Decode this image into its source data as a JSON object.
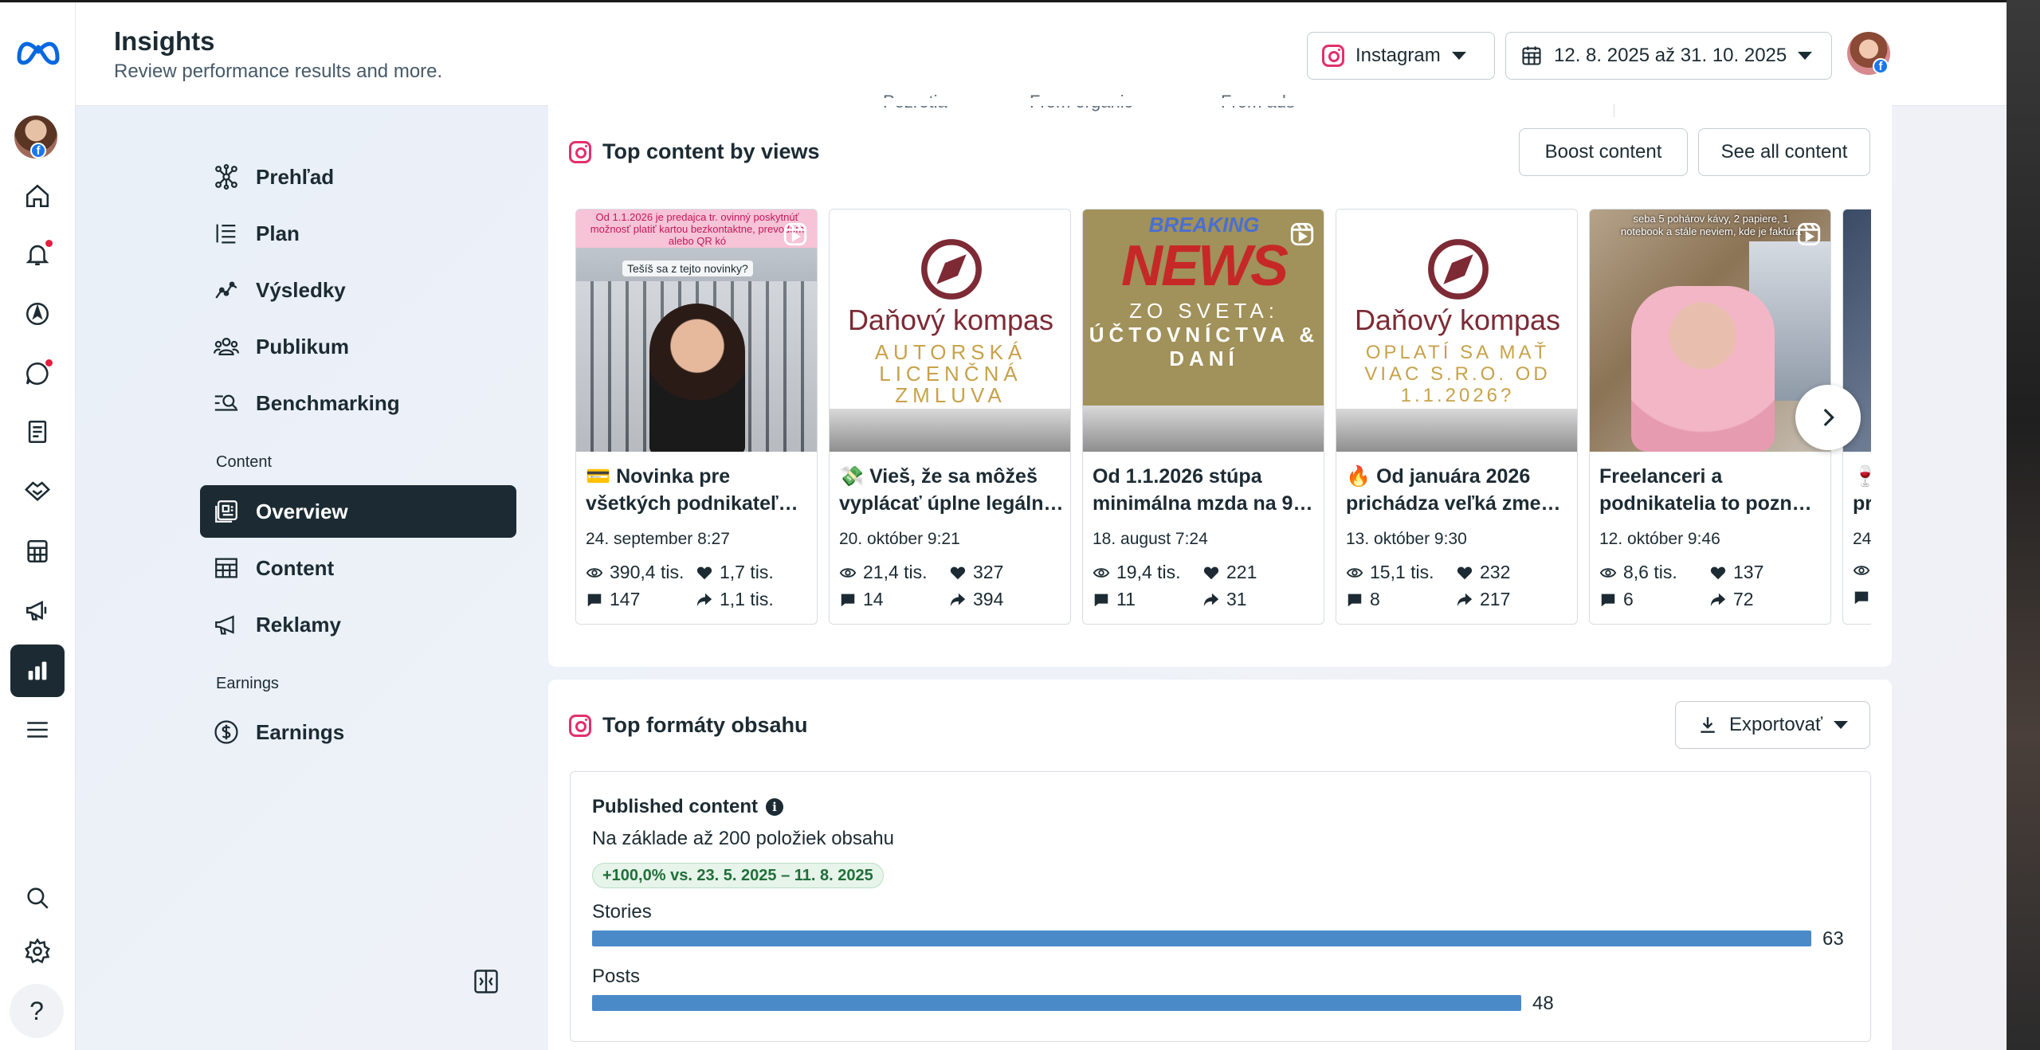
{
  "header": {
    "title": "Insights",
    "subtitle": "Review performance results and more.",
    "platform": "Instagram",
    "date_range": "12. 8. 2025 až 31. 10. 2025"
  },
  "sidebar": {
    "items": [
      {
        "label": "Prehľad",
        "icon": "network-icon"
      },
      {
        "label": "Plan",
        "icon": "list-icon"
      },
      {
        "label": "Výsledky",
        "icon": "trend-icon"
      },
      {
        "label": "Publikum",
        "icon": "people-icon"
      },
      {
        "label": "Benchmarking",
        "icon": "benchmark-icon"
      }
    ],
    "section_content": "Content",
    "content_items": [
      {
        "label": "Overview",
        "icon": "overview-icon"
      },
      {
        "label": "Content",
        "icon": "table-icon"
      },
      {
        "label": "Reklamy",
        "icon": "megaphone-icon"
      }
    ],
    "section_earnings": "Earnings",
    "earnings_items": [
      {
        "label": "Earnings",
        "icon": "dollar-icon"
      }
    ]
  },
  "top_content": {
    "ghost_labels": [
      "Pozretia",
      "From organic",
      "From ads"
    ],
    "title": "Top content by views",
    "boost_label": "Boost content",
    "see_all_label": "See all content",
    "items": [
      {
        "title_line1": "💳 Novinka pre",
        "title_line2": "všetkých podnikateľ…",
        "date": "24. september 8:27",
        "views": "390,4 tis.",
        "likes": "1,7 tis.",
        "comments": "147",
        "shares": "1,1 tis.",
        "thumb_text_top": "Od 1.1.2026 je predajca tr. ovinný poskytnúť možnosť platiť kartou bezkontaktne, prevodom alebo QR kó",
        "thumb_text_mid": "Tešíš sa z tejto novinky?"
      },
      {
        "title_line1": "💸 Vieš, že sa môžeš",
        "title_line2": "vyplácať úplne legáln…",
        "date": "20. október 9:21",
        "views": "21,4 tis.",
        "likes": "327",
        "comments": "14",
        "shares": "394",
        "brand": "Daňový kompas",
        "tagline_1": "AUTORSKÁ",
        "tagline_2": "LICENČNÁ",
        "tagline_3": "ZMLUVA"
      },
      {
        "title_line1": "Od 1.1.2026 stúpa",
        "title_line2": "minimálna mzda na 9…",
        "date": "18. august 7:24",
        "views": "19,4 tis.",
        "likes": "221",
        "comments": "11",
        "shares": "31",
        "breaking": "BREAKING",
        "news": "NEWS",
        "sub_1": "ZO SVETA:",
        "sub_2": "ÚČTOVNÍCTVA &",
        "sub_3": "DANÍ"
      },
      {
        "title_line1": "🔥 Od januára 2026",
        "title_line2": "prichádza veľká zme…",
        "date": "13. október 9:30",
        "views": "15,1 tis.",
        "likes": "232",
        "comments": "8",
        "shares": "217",
        "brand": "Daňový kompas",
        "tagline_1": "OPLATÍ SA MAŤ",
        "tagline_2": "VIAC S.R.O. OD",
        "tagline_3": "1.1.2026?"
      },
      {
        "title_line1": "Freelanceri a",
        "title_line2": "podnikatelia to pozn…",
        "date": "12. október 9:46",
        "views": "8,6 tis.",
        "likes": "137",
        "comments": "6",
        "shares": "72",
        "thumb_text_top": "seba 5 pohárov kávy, 2 papiere, 1 notebook a stále neviem, kde je faktúra"
      },
      {
        "title_line1": "🍷",
        "title_line2": "pr",
        "date": "24",
        "views": "",
        "likes": "",
        "comments": "",
        "shares": ""
      }
    ]
  },
  "formats": {
    "title": "Top formáty obsahu",
    "export_label": "Exportovať",
    "published_label": "Published content",
    "basis": "Na základe až 200 položiek obsahu",
    "change": "+100,0% vs. 23. 5. 2025 – 11. 8. 2025",
    "bars": [
      {
        "label": "Stories",
        "value": 63
      },
      {
        "label": "Posts",
        "value": 48
      }
    ],
    "max": 63
  }
}
